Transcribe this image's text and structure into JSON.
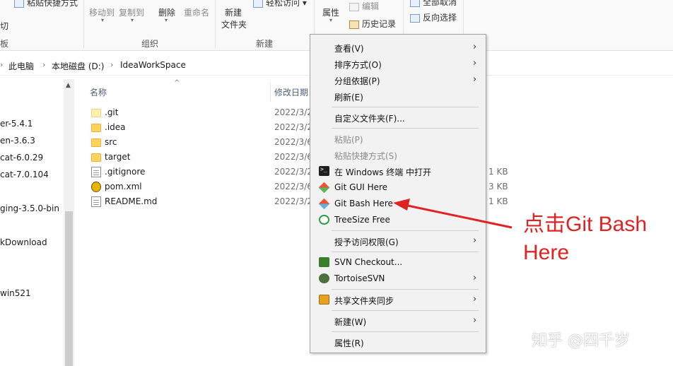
{
  "ribbon": {
    "clipboard_paste_shortcut": "粘贴快捷方式",
    "clipboard_cut": "切",
    "clipboard_group_fragment": "板",
    "organize": {
      "move_to": "移动到",
      "copy_to": "复制到",
      "delete": "删除",
      "rename": "重命名",
      "group": "组织"
    },
    "new": {
      "new_folder_line1": "新建",
      "new_folder_line2": "文件夹",
      "easy_access": "轻松访问",
      "group": "新建"
    },
    "open": {
      "properties": "属性",
      "edit": "编辑",
      "history": "历史记录"
    },
    "select": {
      "select_none": "全部取消",
      "invert_selection": "反向选择"
    }
  },
  "breadcrumb": [
    "此电脑",
    "本地磁盘 (D:)",
    "IdeaWorkSpace"
  ],
  "nav_items": [
    "er-5.4.1",
    "en-3.6.3",
    "cat-6.0.29",
    "cat-7.0.104",
    "ging-3.5.0-bin",
    "kDownload",
    "win521"
  ],
  "file_list": {
    "columns": {
      "name": "名称",
      "date_modified": "修改日期"
    },
    "rows": [
      {
        "name": ".git",
        "date": "2022/3/2",
        "size": "",
        "icon": "folder-icon"
      },
      {
        "name": ".idea",
        "date": "2022/3/2",
        "size": "",
        "icon": "folder-icon"
      },
      {
        "name": "src",
        "date": "2022/3/6",
        "size": "",
        "icon": "folder-icon"
      },
      {
        "name": "target",
        "date": "2022/3/6",
        "size": "",
        "icon": "folder-icon"
      },
      {
        "name": ".gitignore",
        "date": "2022/3/2",
        "size": "1 KB",
        "icon": "file-icon"
      },
      {
        "name": "pom.xml",
        "date": "2022/3/6",
        "size": "3 KB",
        "icon": "xml-icon"
      },
      {
        "name": "README.md",
        "date": "2022/3/2",
        "size": "1 KB",
        "icon": "file-icon"
      }
    ]
  },
  "context_menu": {
    "view": "查看(V)",
    "sort_by": "排序方式(O)",
    "group_by": "分组依据(P)",
    "refresh": "刷新(E)",
    "customize_folder": "自定义文件夹(F)...",
    "paste": "粘贴(P)",
    "paste_shortcut": "粘贴快捷方式(S)",
    "open_in_terminal": "在 Windows 终端 中打开",
    "git_gui": "Git GUI Here",
    "git_bash": "Git Bash Here",
    "treesize": "TreeSize Free",
    "give_access": "授予访问权限(G)",
    "svn_checkout": "SVN Checkout...",
    "tortoise_svn": "TortoiseSVN",
    "sync_share": "共享文件夹同步",
    "new": "新建(W)",
    "properties": "属性(R)"
  },
  "annotation": {
    "line1": "点击Git Bash",
    "line2": "Here",
    "color": "#e02222"
  },
  "watermark": "知乎 @四千岁"
}
